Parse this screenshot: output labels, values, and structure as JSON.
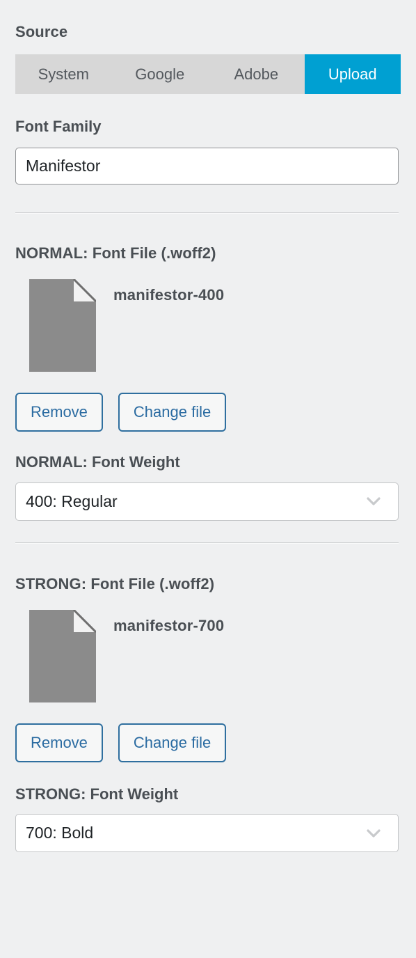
{
  "source": {
    "heading": "Source",
    "tabs": [
      {
        "label": "System",
        "active": false
      },
      {
        "label": "Google",
        "active": false
      },
      {
        "label": "Adobe",
        "active": false
      },
      {
        "label": "Upload",
        "active": true
      }
    ],
    "active_tab": "Upload"
  },
  "font_family": {
    "label": "Font Family",
    "value": "Manifestor",
    "placeholder": "Font Family"
  },
  "normal": {
    "file_heading": "NORMAL: Font File (.woff2)",
    "file_name": "manifestor-400",
    "remove_label": "Remove",
    "change_label": "Change file",
    "weight_label": "NORMAL: Font Weight",
    "weight_value": "400: Regular"
  },
  "strong": {
    "file_heading": "STRONG: Font File (.woff2)",
    "file_name": "manifestor-700",
    "remove_label": "Remove",
    "change_label": "Change file",
    "weight_label": "STRONG: Font Weight",
    "weight_value": "700: Bold"
  },
  "icons": {
    "file": "file-document-icon",
    "chevron": "chevron-down-icon"
  },
  "colors": {
    "page_background": "#eff0f1",
    "tab_inactive_background": "#d7d7d7",
    "tab_active_background": "#00a0d2",
    "tab_active_text": "#ffffff",
    "heading_text": "#4a4f54",
    "button_border": "#2f6f9f",
    "button_text": "#2a6ba1",
    "file_icon_fill": "#8b8b8b",
    "input_border": "#8f9194",
    "select_border": "#c2c4c6",
    "chevron": "#c8cacc",
    "divider": "#cdcfd1"
  }
}
